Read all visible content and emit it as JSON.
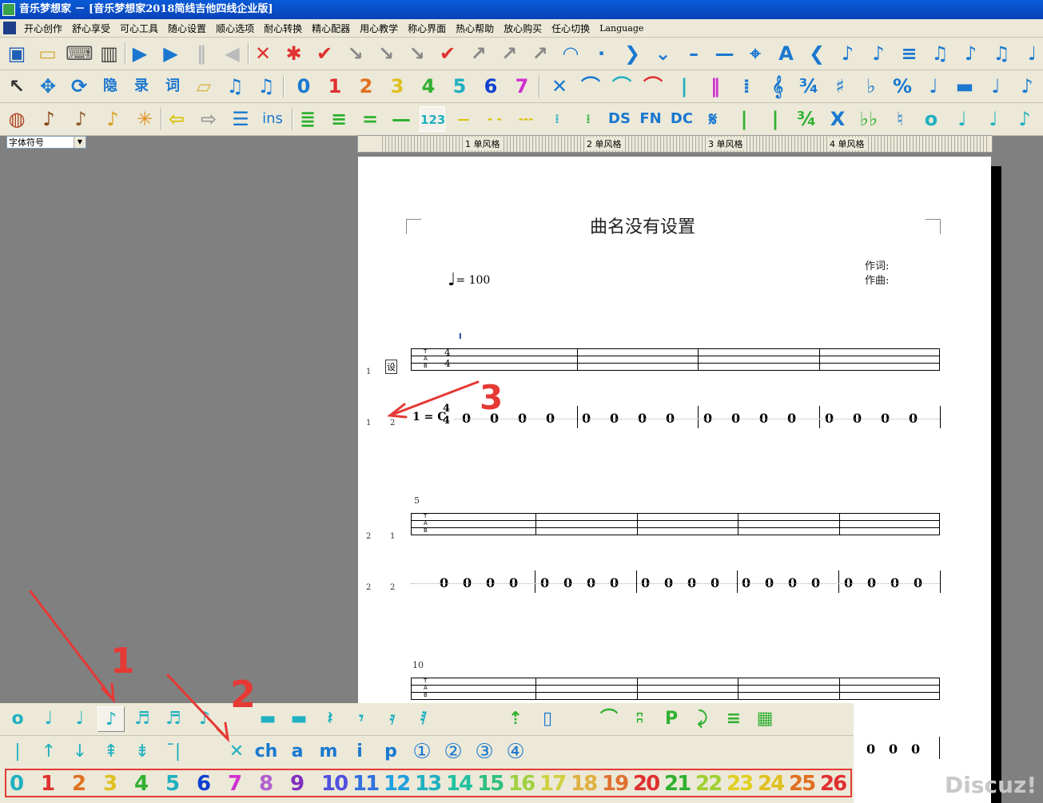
{
  "window": {
    "title": "音乐梦想家 － [音乐梦想家2018简线吉他四线企业版]"
  },
  "menu": {
    "items": [
      "开心创作",
      "舒心享受",
      "可心工具",
      "随心设置",
      "顺心选项",
      "耐心转换",
      "精心配器",
      "用心教学",
      "称心界面",
      "热心帮助",
      "放心购买",
      "任心切换",
      "Language"
    ]
  },
  "toolbar1": {
    "icons": [
      {
        "name": "save-icon",
        "glyph": "▣",
        "color": "#1f5fb8"
      },
      {
        "name": "open-folder-icon",
        "glyph": "▭",
        "color": "#d8a83a"
      },
      {
        "name": "keyboard-icon",
        "glyph": "⌨",
        "color": "#555555"
      },
      {
        "name": "piano-icon",
        "glyph": "▥",
        "color": "#444444"
      },
      {
        "name": "play-icon",
        "glyph": "▶",
        "color": "#1a78d0"
      },
      {
        "name": "play-from-icon",
        "glyph": "▶",
        "color": "#1a78d0"
      },
      {
        "name": "pause-icon",
        "glyph": "‖",
        "color": "#bbbbbb"
      },
      {
        "name": "rewind-icon",
        "glyph": "◀",
        "color": "#bbbbbb"
      },
      {
        "name": "tie-cross-icon",
        "glyph": "✕",
        "color": "#e03030"
      },
      {
        "name": "asterisk-red-icon",
        "glyph": "✱",
        "color": "#e03030"
      },
      {
        "name": "check-icon",
        "glyph": "✔",
        "color": "#e03030"
      },
      {
        "name": "level-meter-icon",
        "glyph": "↘",
        "color": "#888888"
      },
      {
        "name": "level-meter-2-icon",
        "glyph": "↘",
        "color": "#888888"
      },
      {
        "name": "level-meter-3-icon",
        "glyph": "↘",
        "color": "#888888"
      },
      {
        "name": "spell-check-icon",
        "glyph": "✔",
        "color": "#e03030"
      },
      {
        "name": "arrow-up-right-icon",
        "glyph": "↗",
        "color": "#888888"
      },
      {
        "name": "level-meter-4-icon",
        "glyph": "↗",
        "color": "#888888"
      },
      {
        "name": "level-meter-5-icon",
        "glyph": "↗",
        "color": "#888888"
      },
      {
        "name": "fermata-icon",
        "glyph": "◠",
        "color": "#1a78d0"
      },
      {
        "name": "dot-icon",
        "glyph": "·",
        "color": "#1a78d0"
      },
      {
        "name": "chevron-right-icon",
        "glyph": "❯",
        "color": "#1a78d0"
      },
      {
        "name": "chevron-down-icon",
        "glyph": "⌄",
        "color": "#1a78d0"
      },
      {
        "name": "dash-icon",
        "glyph": "–",
        "color": "#1a78d0"
      },
      {
        "name": "long-dash-icon",
        "glyph": "—",
        "color": "#1a78d0"
      },
      {
        "name": "crosshair-icon",
        "glyph": "⌖",
        "color": "#1a78d0"
      },
      {
        "name": "font-a-icon",
        "glyph": "A",
        "color": "#1a78d0"
      },
      {
        "name": "chevron-left-icon",
        "glyph": "❮",
        "color": "#1a78d0"
      },
      {
        "name": "add-note-icon",
        "glyph": "♪",
        "color": "#1a78d0"
      },
      {
        "name": "remove-note-icon",
        "glyph": "♪",
        "color": "#1a78d0"
      },
      {
        "name": "stack-icon",
        "glyph": "≡",
        "color": "#1a78d0"
      },
      {
        "name": "music-note-icon",
        "glyph": "♫",
        "color": "#1a78d0"
      },
      {
        "name": "note-pressed-icon",
        "glyph": "♪",
        "color": "#1a78d0"
      },
      {
        "name": "music-note-2-icon",
        "glyph": "♫",
        "color": "#1a78d0"
      },
      {
        "name": "music-note-3-icon",
        "glyph": "♩",
        "color": "#1a78d0"
      }
    ]
  },
  "toolbar2": {
    "icons": [
      {
        "name": "cursor-icon",
        "glyph": "↖",
        "color": "#333333"
      },
      {
        "name": "move-icon",
        "glyph": "✥",
        "color": "#1a78d0"
      },
      {
        "name": "transform-icon",
        "glyph": "⟳",
        "color": "#1a78d0"
      },
      {
        "name": "hide-icon",
        "glyph": "隐",
        "color": "#1a78d0"
      },
      {
        "name": "record-icon",
        "glyph": "录",
        "color": "#1a78d0"
      },
      {
        "name": "lyrics-icon",
        "glyph": "词",
        "color": "#1a78d0"
      },
      {
        "name": "eraser-icon",
        "glyph": "▱",
        "color": "#d8b040"
      },
      {
        "name": "beam-notes-icon",
        "glyph": "♫",
        "color": "#1a78d0"
      },
      {
        "name": "beam-notes-2-icon",
        "glyph": "♫",
        "color": "#1a78d0"
      }
    ],
    "digits": [
      {
        "label": "0",
        "color": "#1a78d0"
      },
      {
        "label": "1",
        "color": "#e03030"
      },
      {
        "label": "2",
        "color": "#e07020"
      },
      {
        "label": "3",
        "color": "#e0c020"
      },
      {
        "label": "4",
        "color": "#30b030"
      },
      {
        "label": "5",
        "color": "#20b0c0"
      },
      {
        "label": "6",
        "color": "#1040d0"
      },
      {
        "label": "7",
        "color": "#d030d0"
      }
    ],
    "icons2": [
      {
        "name": "cross-icon",
        "glyph": "✕",
        "color": "#1a78d0"
      },
      {
        "name": "slur-icon",
        "glyph": "⌒",
        "color": "#1a78d0"
      },
      {
        "name": "tie-icon",
        "glyph": "⌒",
        "color": "#20b0c0"
      },
      {
        "name": "slur-red-icon",
        "glyph": "⌒",
        "color": "#e03030"
      },
      {
        "name": "barline-icon",
        "glyph": "|",
        "color": "#20b0c0"
      },
      {
        "name": "double-barline-icon",
        "glyph": "‖",
        "color": "#d030d0"
      },
      {
        "name": "repeat-icon",
        "glyph": "⁞",
        "color": "#1a78d0"
      },
      {
        "name": "treble-clef-icon",
        "glyph": "𝄞",
        "color": "#1a78d0"
      },
      {
        "name": "time-sig-icon",
        "glyph": "¾",
        "color": "#1a78d0"
      },
      {
        "name": "sharp-icon",
        "glyph": "♯",
        "color": "#1a78d0"
      },
      {
        "name": "flat-icon",
        "glyph": "♭",
        "color": "#1a78d0"
      },
      {
        "name": "percent-icon",
        "glyph": "%",
        "color": "#1a78d0"
      },
      {
        "name": "quarter-note-icon",
        "glyph": "♩",
        "color": "#1a78d0"
      },
      {
        "name": "rest-icon",
        "glyph": "▬",
        "color": "#1a78d0"
      },
      {
        "name": "quarter-note-2-icon",
        "glyph": "♩",
        "color": "#1a78d0"
      },
      {
        "name": "eighth-note-icon",
        "glyph": "♪",
        "color": "#1a78d0"
      }
    ]
  },
  "toolbar3": {
    "icons": [
      {
        "name": "drum-icon",
        "glyph": "◍",
        "color": "#b04020"
      },
      {
        "name": "violin-icon",
        "glyph": "♪",
        "color": "#8b4513"
      },
      {
        "name": "pipa-icon",
        "glyph": "♪",
        "color": "#8b5a2b"
      },
      {
        "name": "saxophone-icon",
        "glyph": "♪",
        "color": "#d8a020"
      },
      {
        "name": "orchestra-icon",
        "glyph": "✳",
        "color": "#e09020"
      },
      {
        "name": "arrow-left-icon",
        "glyph": "⇦",
        "color": "#d8c000"
      },
      {
        "name": "arrow-right-icon",
        "glyph": "⇨",
        "color": "#999999"
      },
      {
        "name": "lines-icon",
        "glyph": "☰",
        "color": "#1a78d0"
      }
    ],
    "ins_label": "ins",
    "icons2": [
      {
        "name": "align-4-icon",
        "glyph": "≣",
        "color": "#30b030"
      },
      {
        "name": "align-3-icon",
        "glyph": "≡",
        "color": "#30b030"
      },
      {
        "name": "align-2-icon",
        "glyph": "=",
        "color": "#30b030"
      },
      {
        "name": "align-1-icon",
        "glyph": "—",
        "color": "#30b030"
      }
    ],
    "num_label": "123",
    "icons3": [
      {
        "name": "dash-yellow-icon",
        "glyph": "—",
        "color": "#d8c000"
      },
      {
        "name": "dash-dash-icon",
        "glyph": "- -",
        "color": "#d8c000"
      },
      {
        "name": "dash-dots-icon",
        "glyph": "---",
        "color": "#d8c000"
      },
      {
        "name": "repeat-start-icon",
        "glyph": "⁞",
        "color": "#20b0c0"
      },
      {
        "name": "repeat-end-icon",
        "glyph": "⁞",
        "color": "#30b030"
      }
    ],
    "ds_label": "DS",
    "fn_label": "FN",
    "dc_label": "DC",
    "icons4": [
      {
        "name": "segno-icon",
        "glyph": "𝄋",
        "color": "#1a78d0"
      },
      {
        "name": "barline-green-icon",
        "glyph": "|",
        "color": "#30b030"
      },
      {
        "name": "barline-green-2-icon",
        "glyph": "|",
        "color": "#30b030"
      },
      {
        "name": "time-sig-green-icon",
        "glyph": "¾",
        "color": "#30b030"
      },
      {
        "name": "double-sharp-icon",
        "glyph": "X",
        "color": "#1a78d0"
      },
      {
        "name": "double-flat-icon",
        "glyph": "♭♭",
        "color": "#30b030"
      },
      {
        "name": "natural-icon",
        "glyph": "♮",
        "color": "#1a78d0"
      },
      {
        "name": "whole-note-icon",
        "glyph": "o",
        "color": "#20b0c0"
      },
      {
        "name": "half-note-icon",
        "glyph": "♩",
        "color": "#20b0c0"
      },
      {
        "name": "quarter-note-cyan-icon",
        "glyph": "♩",
        "color": "#20b0c0"
      },
      {
        "name": "eighth-note-cyan-icon",
        "glyph": "♪",
        "color": "#20b0c0"
      }
    ]
  },
  "font_select": {
    "value": "字体符号"
  },
  "ruler": {
    "labels": [
      {
        "num": "1",
        "text": "单风格"
      },
      {
        "num": "2",
        "text": "单风格"
      },
      {
        "num": "3",
        "text": "单风格"
      },
      {
        "num": "4",
        "text": "单风格"
      }
    ]
  },
  "score": {
    "title": "曲名没有设置",
    "lyricist_label": "作词:",
    "composer_label": "作曲:",
    "tempo_value": "= 100",
    "cursor_mark": "I",
    "set_label": "设",
    "tab_letters": [
      "T",
      "A",
      "B"
    ],
    "time_sig_top": "4",
    "time_sig_bottom": "4",
    "key_label": "1 = C",
    "measure_5": "5",
    "measure_10": "10",
    "row_labels": {
      "r1a": "1",
      "r1b": "1",
      "r1c": "2",
      "r2a": "2",
      "r2b": "1",
      "r3a": "2",
      "r3b": "2"
    },
    "rest_digit": "0"
  },
  "annotations": {
    "one": "1",
    "two": "2",
    "three": "3",
    "arrow_color": "#e53935"
  },
  "bottom_row1": {
    "icons": [
      {
        "name": "whole-note-icon",
        "glyph": "o",
        "color": "#20b0c0"
      },
      {
        "name": "half-note-icon",
        "glyph": "♩",
        "color": "#20b0c0"
      },
      {
        "name": "quarter-note-icon",
        "glyph": "♩",
        "color": "#20b0c0"
      },
      {
        "name": "eighth-note-icon",
        "glyph": "♪",
        "color": "#20b0c0",
        "pressed": true
      },
      {
        "name": "sixteenth-note-icon",
        "glyph": "♬",
        "color": "#20b0c0"
      },
      {
        "name": "thirty-second-note-icon",
        "glyph": "♬",
        "color": "#20b0c0"
      },
      {
        "name": "grace-note-icon",
        "glyph": "♪",
        "color": "#20b0c0"
      }
    ],
    "icons2": [
      {
        "name": "rest-bar-icon",
        "glyph": "▬",
        "color": "#20b0c0"
      },
      {
        "name": "rest-bar-2-icon",
        "glyph": "▬",
        "color": "#20b0c0"
      },
      {
        "name": "quarter-rest-icon",
        "glyph": "𝄽",
        "color": "#20b0c0"
      },
      {
        "name": "eighth-rest-icon",
        "glyph": "𝄾",
        "color": "#20b0c0"
      },
      {
        "name": "sixteenth-rest-icon",
        "glyph": "𝄿",
        "color": "#20b0c0"
      },
      {
        "name": "thirtysecond-rest-icon",
        "glyph": "𝅀",
        "color": "#20b0c0"
      }
    ],
    "icons3": [
      {
        "name": "arpeggio-icon",
        "glyph": "⇡",
        "color": "#30b030"
      },
      {
        "name": "chord-box-icon",
        "glyph": "▯",
        "color": "#1a78d0"
      },
      {
        "name": "slur-green-icon",
        "glyph": "⌒",
        "color": "#30b030"
      },
      {
        "name": "hammer-icon",
        "glyph": "ʭ",
        "color": "#30b030"
      },
      {
        "name": "pull-off-icon",
        "glyph": "P",
        "color": "#30b030"
      },
      {
        "name": "slide-icon",
        "glyph": "⤸",
        "color": "#30b030"
      },
      {
        "name": "tremolo-icon",
        "glyph": "≡",
        "color": "#30b030"
      },
      {
        "name": "fretboard-icon",
        "glyph": "▦",
        "color": "#30b030"
      }
    ]
  },
  "bottom_row2": {
    "icons": [
      {
        "name": "stroke-icon",
        "glyph": "|",
        "color": "#20b0c0"
      },
      {
        "name": "stroke-up-icon",
        "glyph": "↑",
        "color": "#20b0c0"
      },
      {
        "name": "stroke-down-icon",
        "glyph": "↓",
        "color": "#20b0c0"
      },
      {
        "name": "arpeggio-up-icon",
        "glyph": "⇞",
        "color": "#20b0c0"
      },
      {
        "name": "arpeggio-down-icon",
        "glyph": "⇟",
        "color": "#20b0c0"
      },
      {
        "name": "mute-stroke-icon",
        "glyph": "¯|",
        "color": "#20b0c0"
      },
      {
        "name": "x-note-icon",
        "glyph": "✕",
        "color": "#20b0c0"
      }
    ],
    "ch_label": "ch",
    "a_label": "a",
    "m_label": "m",
    "i_label": "i",
    "p_label": "p",
    "circled": [
      "①",
      "②",
      "③",
      "④"
    ]
  },
  "bottom_numbers": {
    "items": [
      {
        "label": "0",
        "color": "#20b0c0"
      },
      {
        "label": "1",
        "color": "#e03030"
      },
      {
        "label": "2",
        "color": "#e07020"
      },
      {
        "label": "3",
        "color": "#e0c020"
      },
      {
        "label": "4",
        "color": "#30b030"
      },
      {
        "label": "5",
        "color": "#20b0c0"
      },
      {
        "label": "6",
        "color": "#1040d0"
      },
      {
        "label": "7",
        "color": "#d030d0"
      },
      {
        "label": "8",
        "color": "#b060d0"
      },
      {
        "label": "9",
        "color": "#8030c0"
      },
      {
        "label": "10",
        "color": "#5050e0"
      },
      {
        "label": "11",
        "color": "#3070e0"
      },
      {
        "label": "12",
        "color": "#20a0e0"
      },
      {
        "label": "13",
        "color": "#20b0c0"
      },
      {
        "label": "14",
        "color": "#20c0a0"
      },
      {
        "label": "15",
        "color": "#30c080"
      },
      {
        "label": "16",
        "color": "#a0d040"
      },
      {
        "label": "17",
        "color": "#d0d040"
      },
      {
        "label": "18",
        "color": "#e0b040"
      },
      {
        "label": "19",
        "color": "#e07030"
      },
      {
        "label": "20",
        "color": "#e03030"
      },
      {
        "label": "21",
        "color": "#30b030"
      },
      {
        "label": "22",
        "color": "#a0d030"
      },
      {
        "label": "23",
        "color": "#e0d020"
      },
      {
        "label": "24",
        "color": "#e0c020"
      },
      {
        "label": "25",
        "color": "#e07020"
      },
      {
        "label": "26",
        "color": "#e03030"
      }
    ]
  },
  "watermark": "Discuz!"
}
